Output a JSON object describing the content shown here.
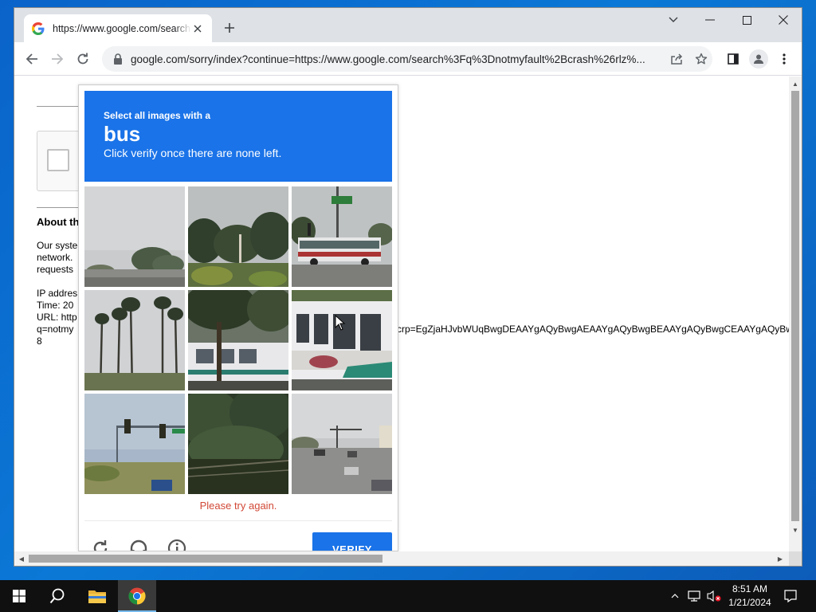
{
  "browser": {
    "tab_title": "https://www.google.com/search?q=notmyfault+crash",
    "url": "google.com/sorry/index?continue=https://www.google.com/search%3Fq%3Dnotmyfault%2Bcrash%26rlz%..."
  },
  "page": {
    "about_title": "About th",
    "lines": [
      "Our syste",
      "network.",
      "requests",
      "IP addres",
      "Time: 20",
      "URL: http",
      "q=notmy",
      "8"
    ],
    "long_line": "crp=EgZjaHJvbWUqBwgDEAAYgAQyBwgAEAAYgAQyBwgBEAAYgAQyBwgCEAAYgAQyBwgDEAAYg"
  },
  "captcha": {
    "subtitle": "Select all images with a",
    "keyword": "bus",
    "instruction": "Click verify once there are none left.",
    "error": "Please try again.",
    "verify_label": "VERIFY",
    "tiles": [
      "street-sky-trees",
      "trees-pole",
      "bus-intersection",
      "palm-trees",
      "bus-behind-trees",
      "bus-closeup",
      "traffic-light",
      "dense-trees",
      "road-cars"
    ]
  },
  "taskbar": {
    "time": "8:51 AM",
    "date": "1/21/2024"
  },
  "colors": {
    "captcha_blue": "#1a73e8",
    "error_red": "#d14836"
  }
}
